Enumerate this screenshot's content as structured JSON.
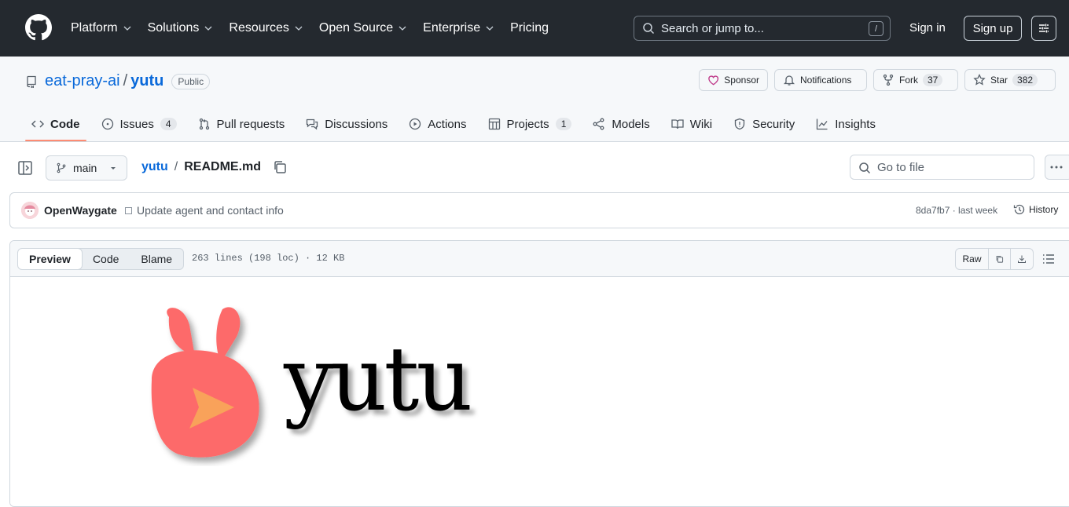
{
  "header": {
    "nav": [
      {
        "label": "Platform",
        "has_menu": true
      },
      {
        "label": "Solutions",
        "has_menu": true
      },
      {
        "label": "Resources",
        "has_menu": true
      },
      {
        "label": "Open Source",
        "has_menu": true
      },
      {
        "label": "Enterprise",
        "has_menu": true
      },
      {
        "label": "Pricing",
        "has_menu": false
      }
    ],
    "search_placeholder": "Search or jump to...",
    "search_shortcut": "/",
    "sign_in": "Sign in",
    "sign_up": "Sign up"
  },
  "repo": {
    "owner": "eat-pray-ai",
    "separator": "/",
    "name": "yutu",
    "visibility": "Public",
    "sponsor_label": "Sponsor",
    "notifications_label": "Notifications",
    "fork_label": "Fork",
    "fork_count": "37",
    "star_label": "Star",
    "star_count": "382",
    "tabs": [
      {
        "label": "Code",
        "icon": "code-icon",
        "count": null
      },
      {
        "label": "Issues",
        "icon": "issue-icon",
        "count": "4"
      },
      {
        "label": "Pull requests",
        "icon": "pull-request-icon",
        "count": null
      },
      {
        "label": "Discussions",
        "icon": "discussions-icon",
        "count": null
      },
      {
        "label": "Actions",
        "icon": "actions-icon",
        "count": null
      },
      {
        "label": "Projects",
        "icon": "projects-icon",
        "count": "1"
      },
      {
        "label": "Models",
        "icon": "models-icon",
        "count": null
      },
      {
        "label": "Wiki",
        "icon": "wiki-icon",
        "count": null
      },
      {
        "label": "Security",
        "icon": "security-icon",
        "count": null
      },
      {
        "label": "Insights",
        "icon": "insights-icon",
        "count": null
      }
    ],
    "selected_tab": "Code"
  },
  "file_nav": {
    "branch": "main",
    "breadcrumb_repo": "yutu",
    "breadcrumb_sep": "/",
    "file_name": "README.md",
    "go_to_file_placeholder": "Go to file"
  },
  "commit": {
    "author": "OpenWaygate",
    "message": "Update agent and contact info",
    "sha_time": "8da7fb7 · last week",
    "history_label": "History"
  },
  "file_toolbar": {
    "tabs": [
      "Preview",
      "Code",
      "Blame"
    ],
    "active_tab": "Preview",
    "info": "263 lines (198 loc) · 12 KB",
    "raw_label": "Raw"
  },
  "readme": {
    "logo_text": "yutu",
    "colors": {
      "logo_body": "#fd6b6b",
      "logo_play": "#f9a25a"
    }
  }
}
